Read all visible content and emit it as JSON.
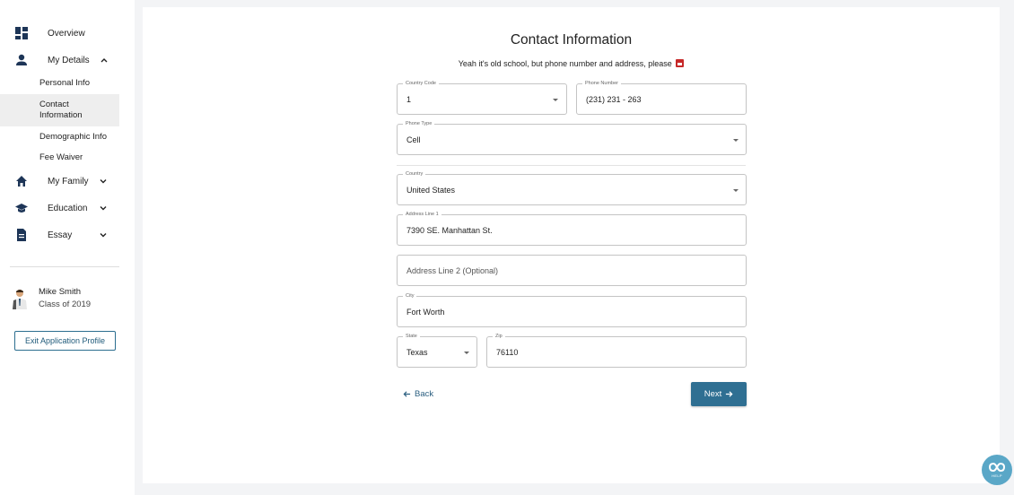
{
  "sidebar": {
    "items": [
      {
        "label": "Overview",
        "icon": "dashboard-icon"
      },
      {
        "label": "My Details",
        "icon": "person-icon"
      },
      {
        "label": "My Family",
        "icon": "home-icon"
      },
      {
        "label": "Education",
        "icon": "graduation-cap-icon"
      },
      {
        "label": "Essay",
        "icon": "document-icon"
      }
    ],
    "sub_items": [
      {
        "label": "Personal Info"
      },
      {
        "label": "Contact Information"
      },
      {
        "label": "Demographic Info"
      },
      {
        "label": "Fee Waiver"
      }
    ],
    "user": {
      "name": "Mike Smith",
      "class": "Class of 2019"
    },
    "exit_label": "Exit Application Profile"
  },
  "form": {
    "title": "Contact Information",
    "subtitle": "Yeah it's old school, but phone number and address, please",
    "country_code": {
      "label": "Country Code",
      "value": "1"
    },
    "phone_number": {
      "label": "Phone Number",
      "value": "(231) 231 - 263"
    },
    "phone_type": {
      "label": "Phone Type",
      "value": "Cell"
    },
    "country": {
      "label": "Country",
      "value": "United States"
    },
    "address1": {
      "label": "Address Line 1",
      "value": "7390 SE. Manhattan St."
    },
    "address2": {
      "placeholder": "Address Line 2 (Optional)"
    },
    "city": {
      "label": "City",
      "value": "Fort Worth"
    },
    "state": {
      "label": "State",
      "value": "Texas"
    },
    "zip": {
      "label": "Zip",
      "value": "76110"
    },
    "back_label": "Back",
    "next_label": "Next"
  },
  "help": {
    "label": "HELP"
  },
  "colors": {
    "accent": "#2f6f92",
    "nav_icon": "#1d3557",
    "help": "#5aa7c7"
  }
}
